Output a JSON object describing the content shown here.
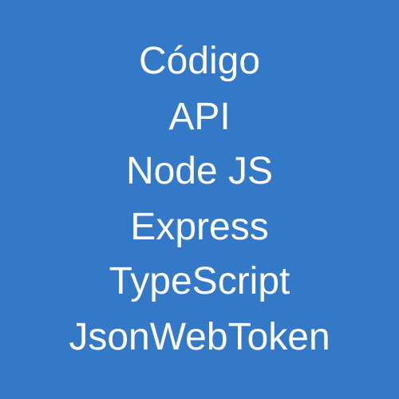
{
  "colors": {
    "background": "#3479c7",
    "text": "#ffffff"
  },
  "lines": [
    "Código",
    "API",
    "Node JS",
    "Express",
    "TypeScript",
    "JsonWebToken"
  ]
}
